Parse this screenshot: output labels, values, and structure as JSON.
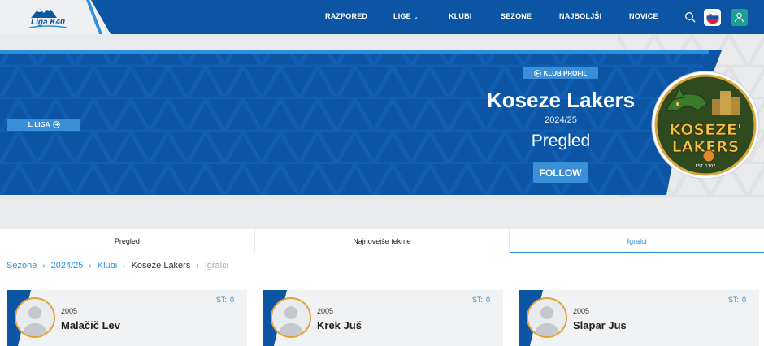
{
  "header": {
    "logo_text": "Liga K40",
    "nav": [
      {
        "label": "RAZPORED"
      },
      {
        "label": "LIGE"
      },
      {
        "label": "KLUBI"
      },
      {
        "label": "SEZONE"
      },
      {
        "label": "NAJBOLJŠI"
      },
      {
        "label": "NOVICE"
      }
    ],
    "search_icon": "search-icon",
    "flag_icon": "slovenia-flag-icon",
    "user_icon": "user-icon"
  },
  "hero": {
    "league_badge": "1. LIGA",
    "club_profile_label": "KLUB PROFIL",
    "club_name": "Koseze Lakers",
    "season": "2024/25",
    "section": "Pregled",
    "follow_label": "FOLLOW",
    "logo_line1": "KOSEZE'",
    "logo_line2": "LAKERS",
    "logo_est": "EST. 1107"
  },
  "tabs": [
    {
      "label": "Pregled",
      "active": false
    },
    {
      "label": "Najnovejše tekme",
      "active": false
    },
    {
      "label": "Igralci",
      "active": true
    }
  ],
  "breadcrumb": [
    {
      "label": "Sezone",
      "kind": "link"
    },
    {
      "label": "2024/25",
      "kind": "link"
    },
    {
      "label": "Klubi",
      "kind": "link"
    },
    {
      "label": "Koseze Lakers",
      "kind": "text"
    },
    {
      "label": "Igralci",
      "kind": "muted"
    }
  ],
  "players": [
    {
      "year": "2005",
      "name": "Malačič Lev",
      "st_label": "ST:",
      "st_value": "0"
    },
    {
      "year": "2005",
      "name": "Krek Juš",
      "st_label": "ST:",
      "st_value": "0"
    },
    {
      "year": "2005",
      "name": "Slapar Jus",
      "st_label": "ST:",
      "st_value": "0"
    }
  ],
  "colors": {
    "primary": "#0b55a4",
    "accent": "#2f8fd8",
    "avatar_border": "#e0a235",
    "user_button": "#1d9e8e"
  }
}
